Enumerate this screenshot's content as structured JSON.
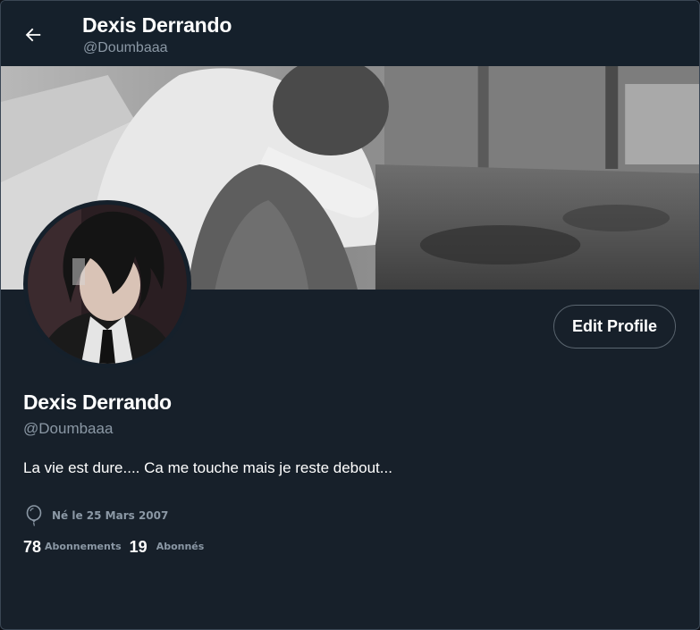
{
  "header": {
    "back_icon": "arrow-left-icon",
    "name": "Dexis Derrando",
    "handle": "@Doumbaaa"
  },
  "banner": {
    "icon": "profile-banner-photo"
  },
  "avatar": {
    "icon": "profile-avatar-image"
  },
  "actions": {
    "edit_label": "Edit Profile"
  },
  "profile": {
    "name": "Dexis Derrando",
    "handle": "@Doumbaaa",
    "bio": "La vie est dure.... Ca me touche mais je reste debout...",
    "birth_icon": "balloon-icon",
    "birth": "Né le 25 Mars 2007"
  },
  "stats": {
    "following_count": "78",
    "following_label": "Abonnements",
    "followers_count": "19",
    "followers_label": "Abonnés"
  },
  "colors": {
    "background": "#17202a",
    "header_background": "#15202b",
    "secondary_text": "#8b98a5",
    "primary_text": "#ffffff",
    "button_border": "#5b6670"
  }
}
